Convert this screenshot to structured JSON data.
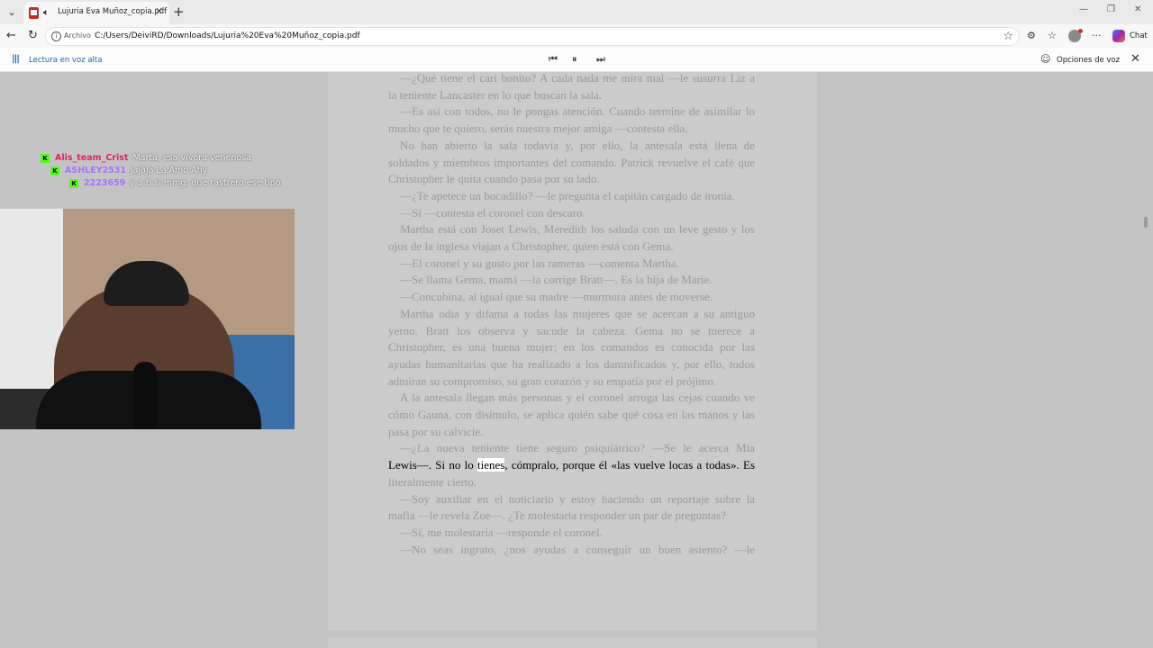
{
  "browser": {
    "tab": {
      "title": "Lujuria Eva Muñoz_copia.pdf"
    },
    "address": {
      "label": "Archivo",
      "url": "C:/Users/DeiviRD/Downloads/Lujuria%20Eva%20Muñoz_copia.pdf"
    },
    "chat_label": "Chat"
  },
  "read_aloud": {
    "label": "Lectura en voz alta",
    "voice_options_label": "Opciones de voz"
  },
  "document": {
    "lines": [
      "—¿Qué tiene el cari bonito? A cada nada me mira mal —le susurra Liz a",
      "la teniente Lancaster en lo que buscan la sala.",
      "—Es así con todos, no le pongas atención. Cuando termine de asimilar lo",
      "mucho que te quiero, serás nuestra mejor amiga —contesta ella.",
      "No han abierto la sala todavía y, por ello, la antesala está llena de",
      "soldados y miembros importantes del comando. Patrick revuelve el café que",
      "Christopher le quita cuando pasa por su lado.",
      "—¿Te apetece un bocadillo? —le pregunta el capitán cargado de ironía.",
      "—Sí —contesta el coronel con descaro.",
      "Martha está con Joset Lewis, Meredith los saluda con un leve gesto y los",
      "ojos de la inglesa viajan a Christopher, quien está con Gema.",
      "—El coronel y su gusto por las rameras —comenta Martha.",
      "—Se llama Gema, mamá —la corrige Bratt—. Es la hija de Marie.",
      "—Concubina, al igual que su madre —murmura antes de moverse.",
      "Martha odia y difama a todas las mujeres que se acercan a su antiguo",
      "yerno. Bratt los observa y sacude la cabeza. Gema no se merece a",
      "Christopher, es una buena mujer; en los comandos es conocida por las",
      "ayudas humanitarias que ha realizado a los damnificados y, por ello, todos",
      "admiran su compromiso, su gran corazón y su empatía por el prójimo.",
      "A la antesala llegan más personas y el coronel arruga las cejas cuando ve",
      "cómo Gauna, con disimulo, se aplica quién sabe qué cosa en las manos y las",
      "pasa por su calvicie.",
      "—¿La nueva teniente tiene seguro psiquiátrico? —Se le acerca Mia"
    ],
    "highlight_before": "Lewis—. Si no lo ",
    "highlight_word": "tienes",
    "highlight_after": ", cómpralo, porque él «las vuelve locas a todas». Es",
    "lines_after": [
      "literalmente cierto.",
      "—Soy auxiliar en el noticiario y estoy haciendo un reportaje sobre la",
      "mafia —le revela Zoe—. ¿Te molestaría responder un par de preguntas?",
      "—Sí, me molestaría —responde el coronel.",
      "—No seas ingrato, ¿nos ayudas a conseguir un buen asiento? —le"
    ]
  },
  "stream_chat": [
    {
      "user": "Alis_team_Crist",
      "text": "Marta, esa vivora venenosa",
      "color": "#e0245e"
    },
    {
      "user": "ASHLEY2531",
      "text": "jajaja La Amo Ahy",
      "color": "#a970ff"
    },
    {
      "user": "2223659",
      "text": "y a ti si mmg, que rastrero ese tipo",
      "color": "#a970ff"
    }
  ]
}
